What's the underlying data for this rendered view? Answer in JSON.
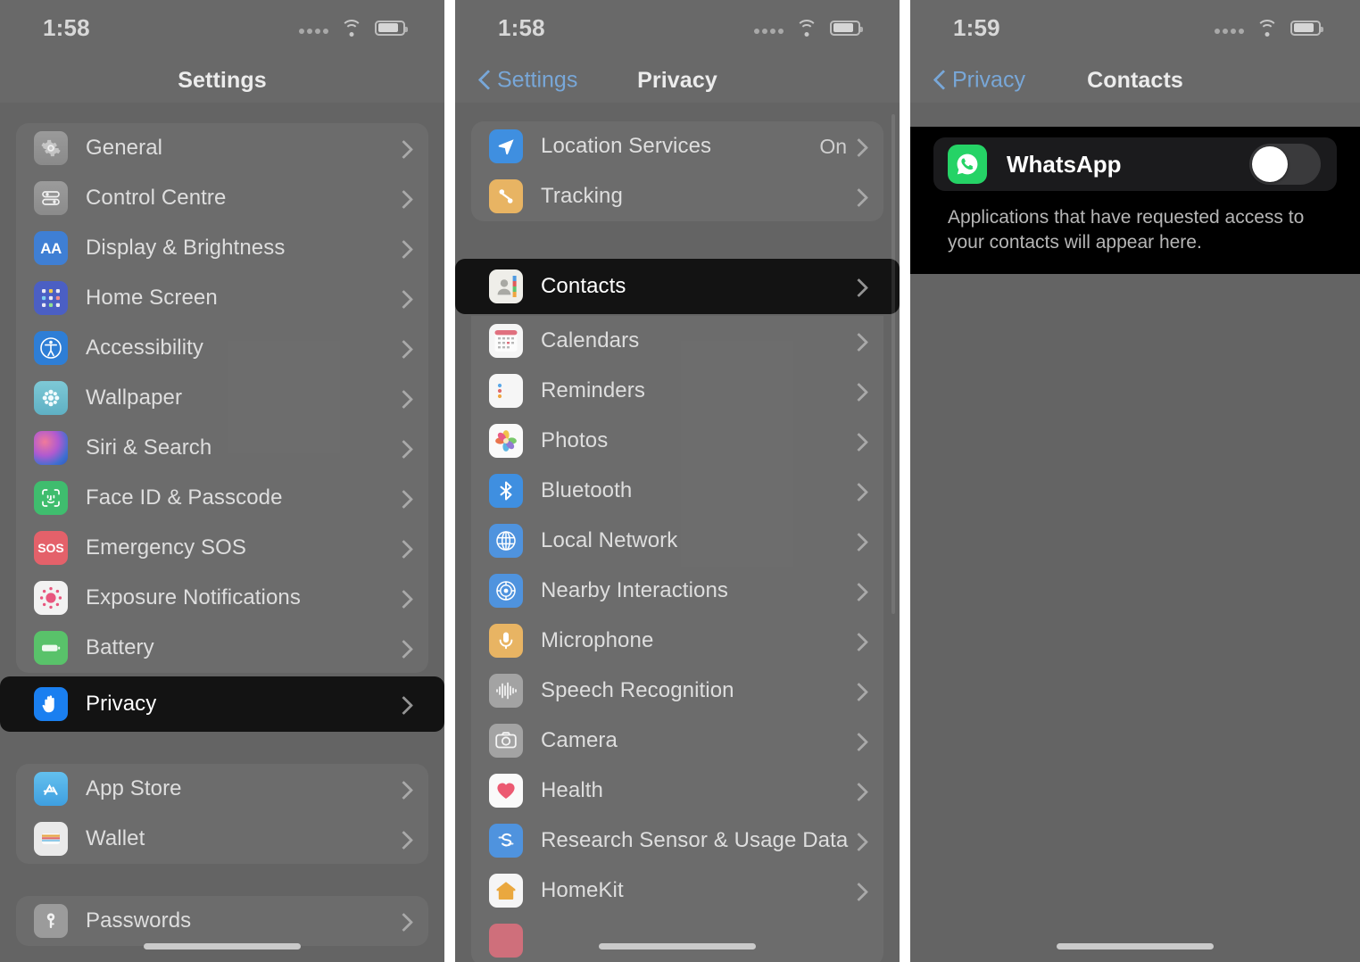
{
  "panels": {
    "settings": {
      "status": {
        "time": "1:58"
      },
      "nav": {
        "title": "Settings"
      },
      "groups": [
        {
          "items": [
            {
              "label": "General",
              "icon": "gear-icon"
            },
            {
              "label": "Control Centre",
              "icon": "control-centre-icon"
            },
            {
              "label": "Display & Brightness",
              "icon": "display-brightness-icon"
            },
            {
              "label": "Home Screen",
              "icon": "home-screen-icon"
            },
            {
              "label": "Accessibility",
              "icon": "accessibility-icon"
            },
            {
              "label": "Wallpaper",
              "icon": "wallpaper-icon"
            },
            {
              "label": "Siri & Search",
              "icon": "siri-icon"
            },
            {
              "label": "Face ID & Passcode",
              "icon": "face-id-icon"
            },
            {
              "label": "Emergency SOS",
              "icon": "emergency-sos-icon"
            },
            {
              "label": "Exposure Notifications",
              "icon": "exposure-notifications-icon"
            },
            {
              "label": "Battery",
              "icon": "battery-icon"
            }
          ]
        },
        {
          "items": [
            {
              "label": "App Store",
              "icon": "app-store-icon"
            },
            {
              "label": "Wallet",
              "icon": "wallet-icon"
            }
          ]
        },
        {
          "items": [
            {
              "label": "Passwords",
              "icon": "passwords-icon"
            }
          ]
        }
      ],
      "highlighted": {
        "label": "Privacy",
        "icon": "privacy-hand-icon"
      }
    },
    "privacy": {
      "status": {
        "time": "1:58"
      },
      "nav": {
        "back_label": "Settings",
        "title": "Privacy"
      },
      "group_top": [
        {
          "label": "Location Services",
          "value": "On",
          "icon": "location-services-icon"
        },
        {
          "label": "Tracking",
          "value": "",
          "icon": "tracking-icon"
        }
      ],
      "highlighted": {
        "label": "Contacts",
        "icon": "contacts-icon"
      },
      "group_main": [
        {
          "label": "Calendars",
          "icon": "calendars-icon"
        },
        {
          "label": "Reminders",
          "icon": "reminders-icon"
        },
        {
          "label": "Photos",
          "icon": "photos-icon"
        },
        {
          "label": "Bluetooth",
          "icon": "bluetooth-icon"
        },
        {
          "label": "Local Network",
          "icon": "local-network-icon"
        },
        {
          "label": "Nearby Interactions",
          "icon": "nearby-interactions-icon"
        },
        {
          "label": "Microphone",
          "icon": "microphone-icon"
        },
        {
          "label": "Speech Recognition",
          "icon": "speech-recognition-icon"
        },
        {
          "label": "Camera",
          "icon": "camera-icon"
        },
        {
          "label": "Health",
          "icon": "health-icon"
        },
        {
          "label": "Research Sensor & Usage Data",
          "icon": "research-sensor-icon"
        },
        {
          "label": "HomeKit",
          "icon": "homekit-icon"
        }
      ]
    },
    "contacts": {
      "status": {
        "time": "1:59"
      },
      "nav": {
        "back_label": "Privacy",
        "title": "Contacts"
      },
      "app": {
        "label": "WhatsApp",
        "icon": "whatsapp-icon",
        "toggle_state": "off"
      },
      "footer_note": "Applications that have requested access to your contacts will appear here."
    }
  },
  "colors": {
    "page_background": "#ffffff",
    "phone_background": "#646464",
    "highlight_background": "#131313",
    "accent_blue": "#78a7d8",
    "toggle_track": "#3a3a3c",
    "whatsapp_green": "#25D366",
    "privacy_blue": "#1a7ff0"
  }
}
